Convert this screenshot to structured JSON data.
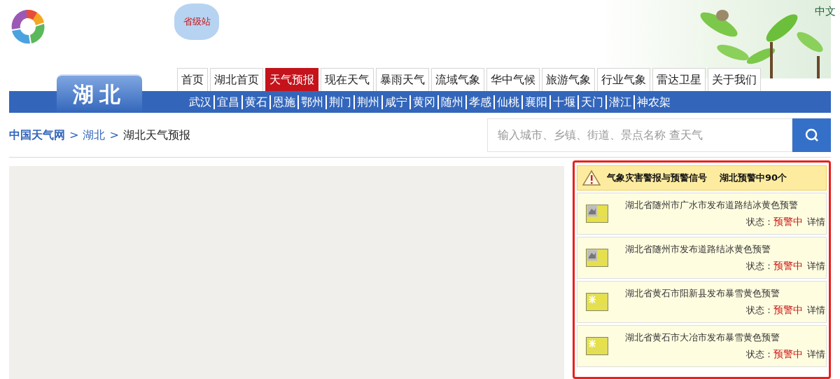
{
  "header": {
    "badge": "省级站",
    "language": "中文",
    "province": "湖北"
  },
  "nav_tabs": [
    {
      "label": "首页",
      "selected": false
    },
    {
      "label": "湖北首页",
      "selected": false
    },
    {
      "label": "天气预报",
      "selected": true
    },
    {
      "label": "现在天气",
      "selected": false
    },
    {
      "label": "暴雨天气",
      "selected": false
    },
    {
      "label": "流域气象",
      "selected": false
    },
    {
      "label": "华中气候",
      "selected": false
    },
    {
      "label": "旅游气象",
      "selected": false
    },
    {
      "label": "行业气象",
      "selected": false
    },
    {
      "label": "雷达卫星",
      "selected": false
    },
    {
      "label": "关于我们",
      "selected": false
    }
  ],
  "cities": [
    "武汉",
    "宜昌",
    "黄石",
    "恩施",
    "鄂州",
    "荆门",
    "荆州",
    "咸宁",
    "黄冈",
    "随州",
    "孝感",
    "仙桃",
    "襄阳",
    "十堰",
    "天门",
    "潜江",
    "神农架"
  ],
  "breadcrumb": [
    "中国天气网",
    ">",
    "湖北",
    ">",
    "湖北天气预报"
  ],
  "search": {
    "placeholder": "输入城市、乡镇、街道、景点名称 查天气"
  },
  "alerts": {
    "title": "气象灾害警报与预警信号",
    "count": "湖北预警中90个",
    "items": [
      {
        "kind": "ice",
        "text": "湖北省随州市广水市发布道路结冰黄色预警",
        "status_label": "状态：",
        "status": "预警中",
        "link": "详情"
      },
      {
        "kind": "ice",
        "text": "湖北省随州市发布道路结冰黄色预警",
        "status_label": "状态：",
        "status": "预警中",
        "link": "详情"
      },
      {
        "kind": "snow",
        "text": "湖北省黄石市阳新县发布暴雪黄色预警",
        "status_label": "状态：",
        "status": "预警中",
        "link": "详情"
      },
      {
        "kind": "snow",
        "text": "湖北省黄石市大冶市发布暴雪黄色预警",
        "status_label": "状态：",
        "status": "预警中",
        "link": "详情"
      }
    ]
  }
}
